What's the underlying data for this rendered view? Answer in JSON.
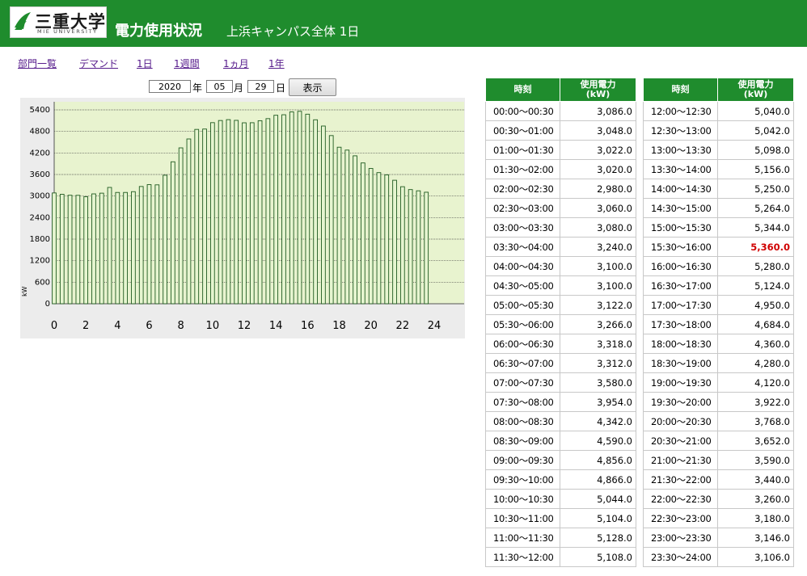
{
  "header": {
    "logo_jp": "三重大学",
    "logo_en": "MIE UNIVERSITY",
    "title": "電力使用状況",
    "subtitle": "上浜キャンパス全体 1日"
  },
  "nav": [
    "部門一覧",
    "デマンド",
    "1日",
    "1週間",
    "1ヵ月",
    "1年"
  ],
  "date_form": {
    "year": "2020",
    "year_label": "年",
    "month": "05",
    "month_label": "月",
    "day": "29",
    "day_label": "日",
    "submit": "表示"
  },
  "colors": {
    "header": "#1f8c2d",
    "plot_bg": "#e8f3cf",
    "bar_fill": "#e6f5d0",
    "bar_border": "#1f5a1f",
    "peak": "#d00000"
  },
  "table": {
    "headers": [
      "時刻",
      "使用電力\n(kW)"
    ],
    "left": [
      [
        "00:00～00:30",
        "3,086.0"
      ],
      [
        "00:30～01:00",
        "3,048.0"
      ],
      [
        "01:00～01:30",
        "3,022.0"
      ],
      [
        "01:30～02:00",
        "3,020.0"
      ],
      [
        "02:00～02:30",
        "2,980.0"
      ],
      [
        "02:30～03:00",
        "3,060.0"
      ],
      [
        "03:00～03:30",
        "3,080.0"
      ],
      [
        "03:30～04:00",
        "3,240.0"
      ],
      [
        "04:00～04:30",
        "3,100.0"
      ],
      [
        "04:30～05:00",
        "3,100.0"
      ],
      [
        "05:00～05:30",
        "3,122.0"
      ],
      [
        "05:30～06:00",
        "3,266.0"
      ],
      [
        "06:00～06:30",
        "3,318.0"
      ],
      [
        "06:30～07:00",
        "3,312.0"
      ],
      [
        "07:00～07:30",
        "3,580.0"
      ],
      [
        "07:30～08:00",
        "3,954.0"
      ],
      [
        "08:00～08:30",
        "4,342.0"
      ],
      [
        "08:30～09:00",
        "4,590.0"
      ],
      [
        "09:00～09:30",
        "4,856.0"
      ],
      [
        "09:30～10:00",
        "4,866.0"
      ],
      [
        "10:00～10:30",
        "5,044.0"
      ],
      [
        "10:30～11:00",
        "5,104.0"
      ],
      [
        "11:00～11:30",
        "5,128.0"
      ],
      [
        "11:30～12:00",
        "5,108.0"
      ]
    ],
    "right": [
      [
        "12:00～12:30",
        "5,040.0"
      ],
      [
        "12:30～13:00",
        "5,042.0"
      ],
      [
        "13:00～13:30",
        "5,098.0"
      ],
      [
        "13:30～14:00",
        "5,156.0"
      ],
      [
        "14:00～14:30",
        "5,250.0"
      ],
      [
        "14:30～15:00",
        "5,264.0"
      ],
      [
        "15:00～15:30",
        "5,344.0"
      ],
      [
        "15:30～16:00",
        "5,360.0"
      ],
      [
        "16:00～16:30",
        "5,280.0"
      ],
      [
        "16:30～17:00",
        "5,124.0"
      ],
      [
        "17:00～17:30",
        "4,950.0"
      ],
      [
        "17:30～18:00",
        "4,684.0"
      ],
      [
        "18:00～18:30",
        "4,360.0"
      ],
      [
        "18:30～19:00",
        "4,280.0"
      ],
      [
        "19:00～19:30",
        "4,120.0"
      ],
      [
        "19:30～20:00",
        "3,922.0"
      ],
      [
        "20:00～20:30",
        "3,768.0"
      ],
      [
        "20:30～21:00",
        "3,652.0"
      ],
      [
        "21:00～21:30",
        "3,590.0"
      ],
      [
        "21:30～22:00",
        "3,440.0"
      ],
      [
        "22:00～22:30",
        "3,260.0"
      ],
      [
        "22:30～23:00",
        "3,180.0"
      ],
      [
        "23:00～23:30",
        "3,146.0"
      ],
      [
        "23:30～24:00",
        "3,106.0"
      ]
    ],
    "peak_value": "5,360.0"
  },
  "chart_data": {
    "type": "bar",
    "ylabel": "kW",
    "ylim": [
      0,
      5400
    ],
    "yticks": [
      0,
      600,
      1200,
      1800,
      2400,
      3000,
      3600,
      4200,
      4800,
      5400
    ],
    "xlim": [
      0,
      24
    ],
    "xticks": [
      0,
      2,
      4,
      6,
      8,
      10,
      12,
      14,
      16,
      18,
      20,
      22,
      24
    ],
    "x": [
      0,
      0.5,
      1,
      1.5,
      2,
      2.5,
      3,
      3.5,
      4,
      4.5,
      5,
      5.5,
      6,
      6.5,
      7,
      7.5,
      8,
      8.5,
      9,
      9.5,
      10,
      10.5,
      11,
      11.5,
      12,
      12.5,
      13,
      13.5,
      14,
      14.5,
      15,
      15.5,
      16,
      16.5,
      17,
      17.5,
      18,
      18.5,
      19,
      19.5,
      20,
      20.5,
      21,
      21.5,
      22,
      22.5,
      23,
      23.5
    ],
    "values": [
      3086,
      3048,
      3022,
      3020,
      2980,
      3060,
      3080,
      3240,
      3100,
      3100,
      3122,
      3266,
      3318,
      3312,
      3580,
      3954,
      4342,
      4590,
      4856,
      4866,
      5044,
      5104,
      5128,
      5108,
      5040,
      5042,
      5098,
      5156,
      5250,
      5264,
      5344,
      5360,
      5280,
      5124,
      4950,
      4684,
      4360,
      4280,
      4120,
      3922,
      3768,
      3652,
      3590,
      3440,
      3260,
      3180,
      3146,
      3106
    ],
    "grid": true
  }
}
